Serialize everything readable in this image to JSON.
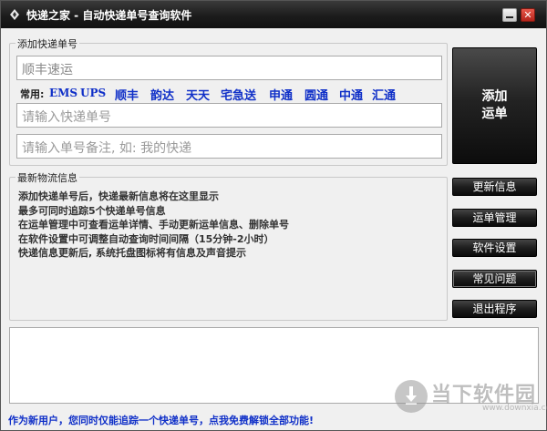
{
  "window": {
    "title": "快递之家 - 自动快递单号查询软件"
  },
  "titlebar": {
    "minimize_icon": "minimize-icon",
    "close_icon": "close-icon",
    "close_glyph": "✕",
    "close_color": "#c4291e"
  },
  "add_group": {
    "legend": "添加快递单号",
    "company_value": "顺丰速运",
    "number_placeholder": "请输入快递单号",
    "note_placeholder": "请输入单号备注, 如: 我的快递",
    "common_label": "常用:",
    "couriers": [
      "EMS",
      "UPS",
      "顺丰",
      "韵达",
      "天天",
      "宅急送",
      "申通",
      "圆通",
      "中通",
      "汇通"
    ],
    "link_color": "#1030c8"
  },
  "add_button": {
    "line1": "添加",
    "line2": "运单"
  },
  "info_group": {
    "legend": "最新物流信息",
    "lines": [
      "添加快递单号后，快递最新信息将在这里显示",
      "最多可同时追踪5个快递单号信息",
      "在运单管理中可查看运单详情、手动更新运单信息、删除单号",
      "在软件设置中可调整自动查询时间间隔（15分钟-2小时）",
      "快递信息更新后, 系统托盘图标将有信息及声音提示"
    ]
  },
  "side_buttons": [
    "更新信息",
    "运单管理",
    "软件设置",
    "常见问题",
    "退出程序"
  ],
  "watermark": {
    "text": "当下软件园",
    "url": "www.downxia.com",
    "icon": "download-arrow-icon"
  },
  "footer": {
    "text": "作为新用户，您同时仅能追踪一个快递单号，点我免费解锁全部功能!"
  }
}
